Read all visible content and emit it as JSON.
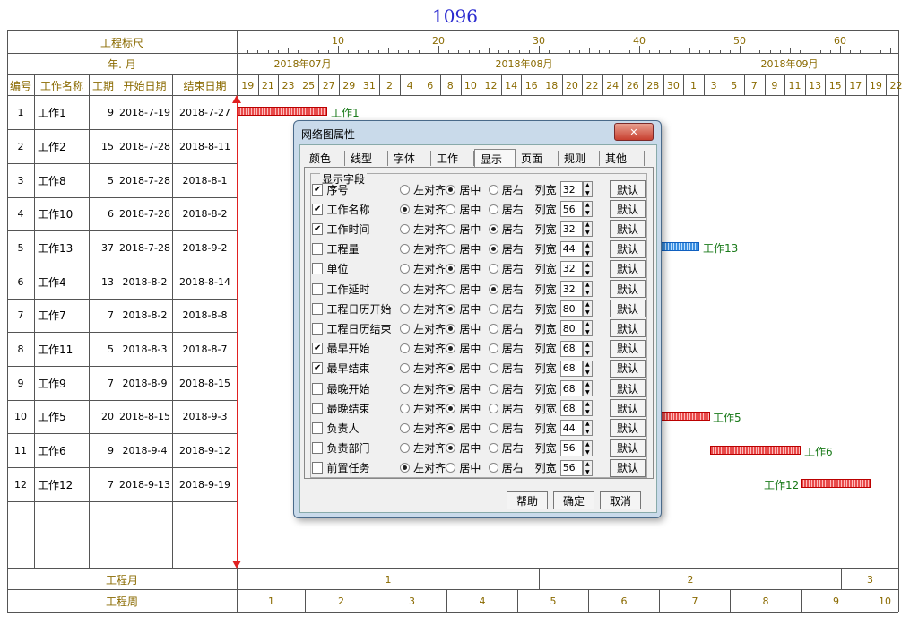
{
  "title": "1096",
  "header": {
    "ruler_label": "工程标尺",
    "ym_label": "年. 月",
    "cols": {
      "id": "编号",
      "name": "工作名称",
      "dur": "工期",
      "start": "开始日期",
      "end": "结束日期"
    },
    "ruler_numbers": [
      "10",
      "20",
      "30",
      "40",
      "50",
      "60"
    ],
    "months": [
      "2018年07月",
      "2018年08月",
      "2018年09月"
    ],
    "days": [
      "19",
      "21",
      "23",
      "25",
      "27",
      "29",
      "31",
      "2",
      "4",
      "6",
      "8",
      "10",
      "12",
      "14",
      "16",
      "18",
      "20",
      "22",
      "24",
      "26",
      "28",
      "30",
      "1",
      "3",
      "5",
      "7",
      "9",
      "11",
      "13",
      "15",
      "17",
      "19",
      "22"
    ]
  },
  "tasks": [
    {
      "id": "1",
      "name": "工作1",
      "dur": "9",
      "start": "2018-7-19",
      "end": "2018-7-27"
    },
    {
      "id": "2",
      "name": "工作2",
      "dur": "15",
      "start": "2018-7-28",
      "end": "2018-8-11"
    },
    {
      "id": "3",
      "name": "工作8",
      "dur": "5",
      "start": "2018-7-28",
      "end": "2018-8-1"
    },
    {
      "id": "4",
      "name": "工作10",
      "dur": "6",
      "start": "2018-7-28",
      "end": "2018-8-2"
    },
    {
      "id": "5",
      "name": "工作13",
      "dur": "37",
      "start": "2018-7-28",
      "end": "2018-9-2"
    },
    {
      "id": "6",
      "name": "工作4",
      "dur": "13",
      "start": "2018-8-2",
      "end": "2018-8-14"
    },
    {
      "id": "7",
      "name": "工作7",
      "dur": "7",
      "start": "2018-8-2",
      "end": "2018-8-8"
    },
    {
      "id": "8",
      "name": "工作11",
      "dur": "5",
      "start": "2018-8-3",
      "end": "2018-8-7"
    },
    {
      "id": "9",
      "name": "工作9",
      "dur": "7",
      "start": "2018-8-9",
      "end": "2018-8-15"
    },
    {
      "id": "10",
      "name": "工作5",
      "dur": "20",
      "start": "2018-8-15",
      "end": "2018-9-3"
    },
    {
      "id": "11",
      "name": "工作6",
      "dur": "9",
      "start": "2018-9-4",
      "end": "2018-9-12"
    },
    {
      "id": "12",
      "name": "工作12",
      "dur": "7",
      "start": "2018-9-13",
      "end": "2018-9-19"
    }
  ],
  "gantt_labels": {
    "task1": "工作1",
    "task13": "工作13",
    "task5": "工作5",
    "task6": "工作6",
    "task12": "工作12"
  },
  "footer": {
    "month_label": "工程月",
    "week_label": "工程周",
    "months": [
      "1",
      "2",
      "3"
    ],
    "weeks": [
      "1",
      "2",
      "3",
      "4",
      "5",
      "6",
      "7",
      "8",
      "9",
      "10"
    ]
  },
  "dialog": {
    "title": "网络图属性",
    "close_glyph": "✕",
    "tabs": [
      "颜色",
      "线型",
      "字体",
      "工作",
      "显示",
      "页面",
      "规则",
      "其他"
    ],
    "active_tab": "显示",
    "group_label": "显示字段",
    "align_left": "左对齐",
    "align_center": "居中",
    "align_right": "居右",
    "width_label": "列宽",
    "default_label": "默认",
    "fields": [
      {
        "checked": true,
        "label": "序号",
        "align": "center",
        "width": "32"
      },
      {
        "checked": true,
        "label": "工作名称",
        "align": "left",
        "width": "56"
      },
      {
        "checked": true,
        "label": "工作时间",
        "align": "right",
        "width": "32"
      },
      {
        "checked": false,
        "label": "工程量",
        "align": "right",
        "width": "44"
      },
      {
        "checked": false,
        "label": "单位",
        "align": "center",
        "width": "32"
      },
      {
        "checked": false,
        "label": "工作延时",
        "align": "right",
        "width": "32"
      },
      {
        "checked": false,
        "label": "工程日历开始",
        "align": "center",
        "width": "80"
      },
      {
        "checked": false,
        "label": "工程日历结束",
        "align": "center",
        "width": "80"
      },
      {
        "checked": true,
        "label": "最早开始",
        "align": "center",
        "width": "68"
      },
      {
        "checked": true,
        "label": "最早结束",
        "align": "center",
        "width": "68"
      },
      {
        "checked": false,
        "label": "最晚开始",
        "align": "center",
        "width": "68"
      },
      {
        "checked": false,
        "label": "最晚结束",
        "align": "center",
        "width": "68"
      },
      {
        "checked": false,
        "label": "负责人",
        "align": "center",
        "width": "44"
      },
      {
        "checked": false,
        "label": "负责部门",
        "align": "center",
        "width": "56"
      },
      {
        "checked": false,
        "label": "前置任务",
        "align": "left",
        "width": "56"
      }
    ],
    "buttons": {
      "help": "帮助",
      "ok": "确定",
      "cancel": "取消"
    }
  }
}
